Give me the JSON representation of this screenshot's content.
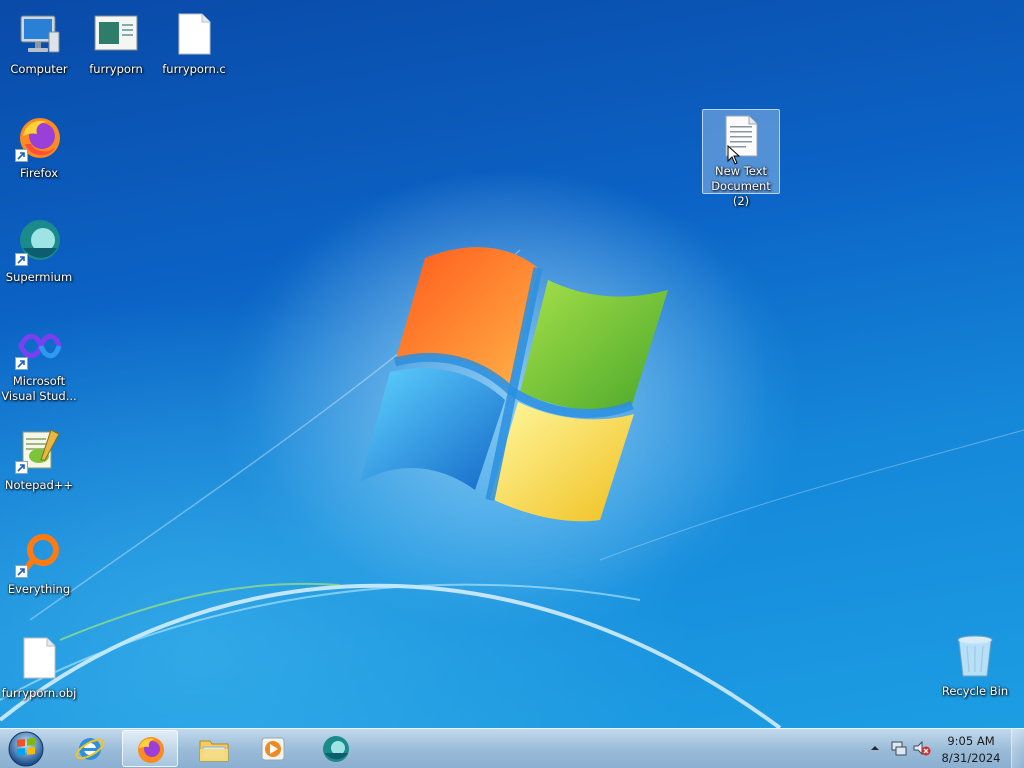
{
  "desktop": {
    "icons": [
      {
        "label": "Computer",
        "icon": "computer-icon",
        "shortcut": false
      },
      {
        "label": "furryporn",
        "icon": "image-file-icon",
        "shortcut": false
      },
      {
        "label": "furryporn.c",
        "icon": "blank-file-icon",
        "shortcut": false
      },
      {
        "label": "Firefox",
        "icon": "firefox-icon",
        "shortcut": true
      },
      {
        "label": "Supermium",
        "icon": "supermium-icon",
        "shortcut": true
      },
      {
        "label": "Microsoft Visual Stud...",
        "icon": "visual-studio-icon",
        "shortcut": true
      },
      {
        "label": "Notepad++",
        "icon": "notepadpp-icon",
        "shortcut": true
      },
      {
        "label": "Everything",
        "icon": "everything-search-icon",
        "shortcut": true
      },
      {
        "label": "furryporn.obj",
        "icon": "blank-file-icon",
        "shortcut": false
      },
      {
        "label": "New Text Document (2)",
        "icon": "text-document-icon",
        "shortcut": false,
        "selected": true
      },
      {
        "label": "Recycle Bin",
        "icon": "recycle-bin-icon",
        "shortcut": false
      }
    ]
  },
  "taskbar": {
    "start": {
      "icon": "windows-start-orb-icon"
    },
    "pinned": [
      {
        "name": "Internet Explorer",
        "icon": "internet-explorer-icon",
        "active": false
      },
      {
        "name": "Firefox",
        "icon": "firefox-icon",
        "active": true
      },
      {
        "name": "Windows Explorer",
        "icon": "folder-icon",
        "active": false
      },
      {
        "name": "Windows Media Player",
        "icon": "media-player-icon",
        "active": false
      },
      {
        "name": "Supermium",
        "icon": "supermium-icon",
        "active": false
      }
    ],
    "tray": {
      "icons": [
        "show-hidden-icons-chevron-icon",
        "network-icon",
        "volume-muted-icon"
      ],
      "time": "9:05 AM",
      "date": "8/31/2024"
    }
  },
  "colors": {
    "wallpaper_top": "#0a4aa8",
    "wallpaper_bottom": "#1c9ee3",
    "selection": "#aacdf0"
  }
}
